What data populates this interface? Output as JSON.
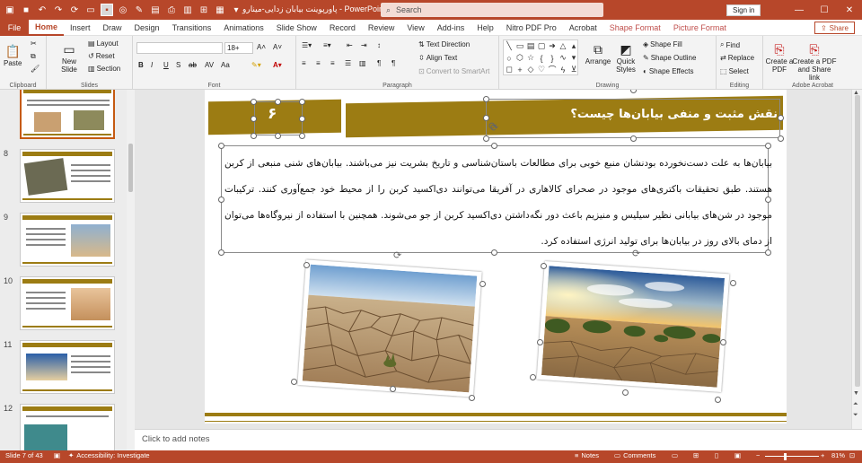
{
  "window": {
    "doc_title": "پاورپوینت بیابان زدایی-مینارو  -  PowerPoint",
    "search_placeholder": "Search",
    "sign_in": "Sign in"
  },
  "tabs": [
    "File",
    "Home",
    "Insert",
    "Draw",
    "Design",
    "Transitions",
    "Animations",
    "Slide Show",
    "Record",
    "Review",
    "View",
    "Add-ins",
    "Help",
    "Nitro PDF Pro",
    "Acrobat",
    "Shape Format",
    "Picture Format"
  ],
  "share_label": "Share",
  "ribbon": {
    "clipboard": {
      "paste": "Paste",
      "label": "Clipboard"
    },
    "slides": {
      "new_slide": "New Slide",
      "layout": "Layout",
      "reset": "Reset",
      "section": "Section",
      "label": "Slides"
    },
    "font": {
      "font_name": "",
      "font_size": "18+",
      "label": "Font"
    },
    "paragraph": {
      "text_direction": "Text Direction",
      "align_text": "Align Text",
      "convert_smartart": "Convert to SmartArt",
      "label": "Paragraph"
    },
    "drawing": {
      "arrange": "Arrange",
      "quick_styles": "Quick Styles",
      "shape_fill": "Shape Fill",
      "shape_outline": "Shape Outline",
      "shape_effects": "Shape Effects",
      "label": "Drawing"
    },
    "editing": {
      "find": "Find",
      "replace": "Replace",
      "select": "Select",
      "label": "Editing"
    },
    "acrobat": {
      "create_pdf": "Create a PDF",
      "create_share": "Create a PDF and Share link",
      "label": "Adobe Acrobat"
    }
  },
  "thumbnails": [
    {
      "num": "",
      "selected": true
    },
    {
      "num": "8",
      "selected": false
    },
    {
      "num": "9",
      "selected": false
    },
    {
      "num": "10",
      "selected": false
    },
    {
      "num": "11",
      "selected": false
    },
    {
      "num": "12",
      "selected": false
    }
  ],
  "slide": {
    "title": "نقش مثبت و منفی بیابان‌ها چیست؟",
    "number": "۶",
    "body": "بیابان‌ها به علت دست‌نخورده بودنشان منبع خوبی برای مطالعات باستان‌شناسی و تاریخ بشریت نیز می‌باشند. بیابان‌های شنی منبعی از کربن هستند. طبق تحقیقات باکتری‌های موجود در صحرای کالاهاری در آفریقا می‌توانند دی‌اکسید کربن را از محیط خود جمع‌آوری کنند. ترکیبات موجود در شن‌های بیابانی نظیر سیلیس و منیزیم باعث دور نگه‌داشتن دی‌اکسید کربن از جو می‌شوند. همچنین با استفاده از نیروگاه‌ها می‌توان از دمای بالای روز در بیابان‌ها برای تولید انرژی استفاده کرد."
  },
  "notes_placeholder": "Click to add notes",
  "status": {
    "slide_count": "Slide 7 of 43",
    "accessibility": "Accessibility: Investigate",
    "notes": "Notes",
    "comments": "Comments",
    "zoom": "81%"
  },
  "colors": {
    "accent": "#b7472a",
    "slide_gold": "#9c7c13"
  }
}
